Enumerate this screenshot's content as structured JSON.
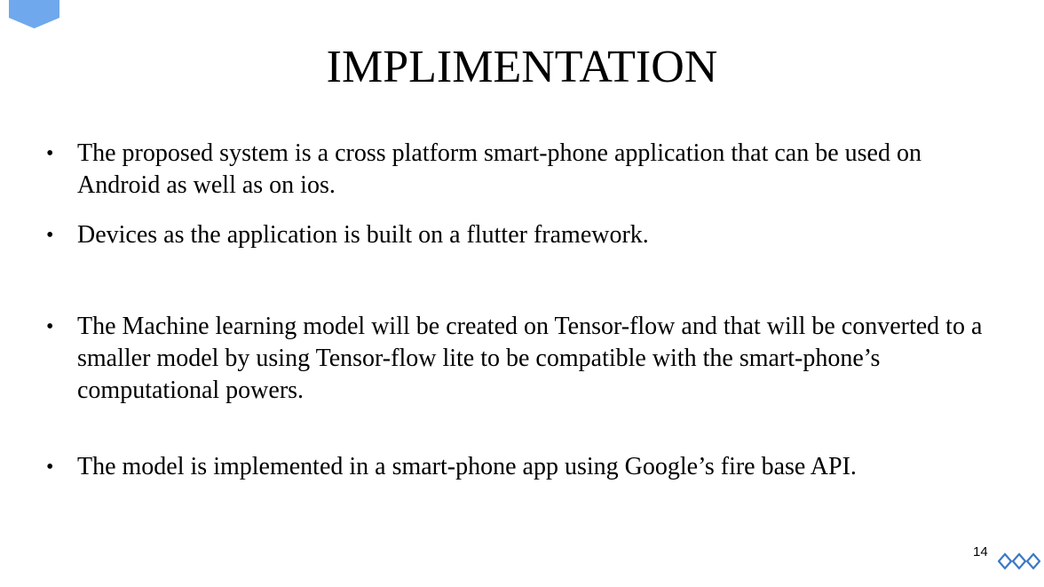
{
  "slide": {
    "title": "IMPLIMENTATION",
    "bullets": [
      {
        "marker": "•",
        "text": "The proposed system is a cross platform smart-phone application that can be used on Android as well as on ios."
      },
      {
        "marker": "•",
        "text": "Devices as the application is built on a flutter framework."
      },
      {
        "marker": "•",
        "text": "The Machine learning model will be created on Tensor-flow and that will be converted to a smaller model by using Tensor-flow lite to be compatible with the smart-phone’s computational powers."
      },
      {
        "marker": "•",
        "text": "The model is implemented in a smart-phone app using Google’s fire base API."
      }
    ],
    "page_number": "14"
  },
  "colors": {
    "accent_blue": "#6fa8ec",
    "diamond_blue": "#3b78c4",
    "text": "#000000",
    "background": "#ffffff"
  },
  "icons": {
    "corner": "blue-pentagon-tab-icon",
    "footer": "three-diamonds-icon"
  }
}
